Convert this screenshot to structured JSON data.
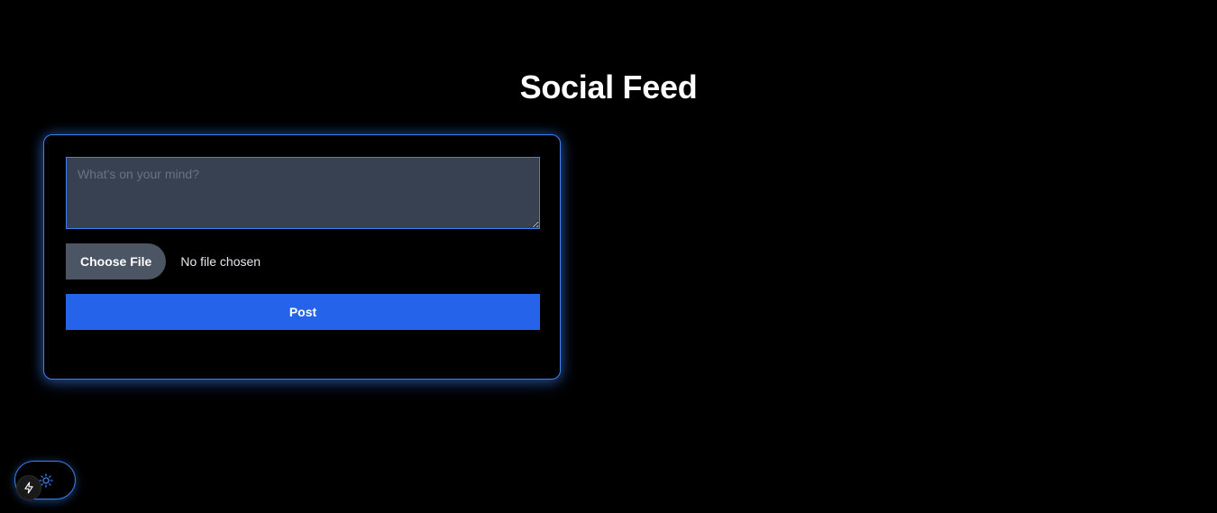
{
  "page": {
    "title": "Social Feed"
  },
  "composer": {
    "textarea_placeholder": "What's on your mind?",
    "textarea_value": "",
    "choose_file_label": "Choose File",
    "file_status": "No file chosen",
    "post_label": "Post"
  },
  "theme_toggle": {
    "icon": "sun-icon"
  },
  "dev_badge": {
    "icon": "lightning-bolt-icon"
  },
  "colors": {
    "background": "#000000",
    "accent": "#3b82f6",
    "post_button": "#2563eb",
    "textarea_bg": "#374151",
    "file_button_bg": "#4b5563"
  }
}
